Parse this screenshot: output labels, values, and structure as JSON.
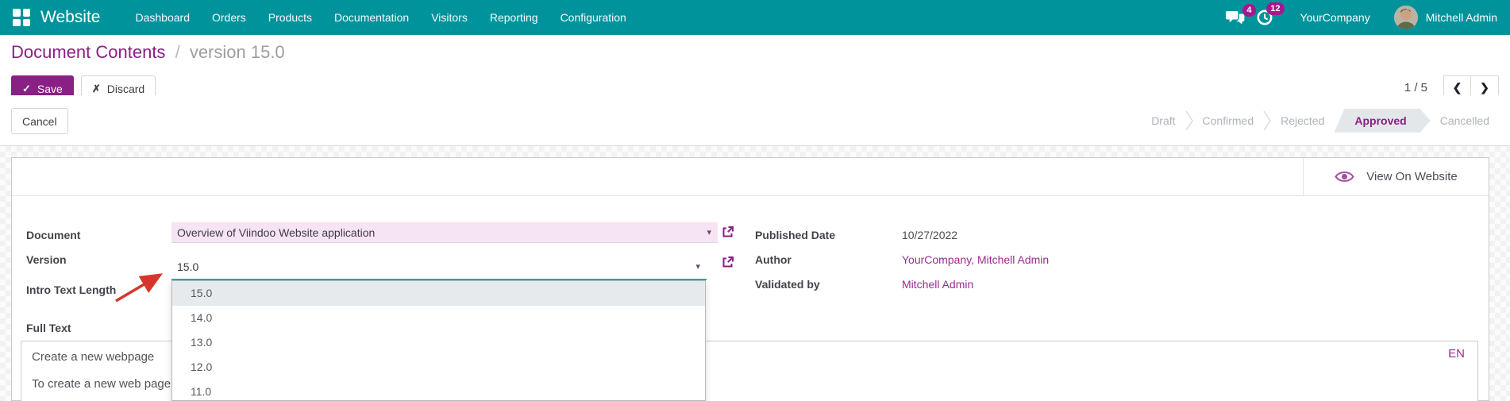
{
  "navbar": {
    "brand": "Website",
    "menu": [
      "Dashboard",
      "Orders",
      "Products",
      "Documentation",
      "Visitors",
      "Reporting",
      "Configuration"
    ],
    "messages_badge": "4",
    "activities_badge": "12",
    "company": "YourCompany",
    "user": "Mitchell Admin"
  },
  "breadcrumb": {
    "title": "Document Contents",
    "separator": "/",
    "subtitle": "version 15.0"
  },
  "actions": {
    "save": "Save",
    "discard": "Discard",
    "cancel": "Cancel",
    "pager": "1 / 5",
    "view_on_website": "View On Website"
  },
  "statusbar": {
    "stages": [
      {
        "label": "Draft",
        "active": false
      },
      {
        "label": "Confirmed",
        "active": false
      },
      {
        "label": "Rejected",
        "active": false
      },
      {
        "label": "Approved",
        "active": true
      },
      {
        "label": "Cancelled",
        "active": false
      }
    ]
  },
  "form": {
    "document": {
      "label": "Document",
      "value": "Overview of Viindoo Website application"
    },
    "version": {
      "label": "Version",
      "value": "15.0"
    },
    "intro_text_length": {
      "label": "Intro Text Length"
    },
    "full_text": {
      "label": "Full Text",
      "line1": "Create a new webpage",
      "line2": "To create a new web page",
      "language": "EN"
    },
    "published_date": {
      "label": "Published Date",
      "value": "10/27/2022"
    },
    "author": {
      "label": "Author",
      "value": "YourCompany, Mitchell Admin"
    },
    "validated_by": {
      "label": "Validated by",
      "value": "Mitchell Admin"
    }
  },
  "version_dropdown": {
    "selected": "15.0",
    "options": [
      "15.0",
      "14.0",
      "13.0",
      "12.0",
      "11.0"
    ]
  },
  "icons": {
    "check": "✓",
    "cross": "✗",
    "caret": "▾",
    "prev": "❮",
    "next": "❯"
  },
  "colors": {
    "navbar_teal": "#00939b",
    "primary_purple": "#8a1f84",
    "link_purple": "#9c2b8f",
    "badge_magenta": "#a5188f",
    "focus_teal": "#2fa6ad",
    "status_active_bg": "#e4e7ea",
    "annotation_red": "#d7352a",
    "document_field_bg": "#f6e4f4"
  }
}
